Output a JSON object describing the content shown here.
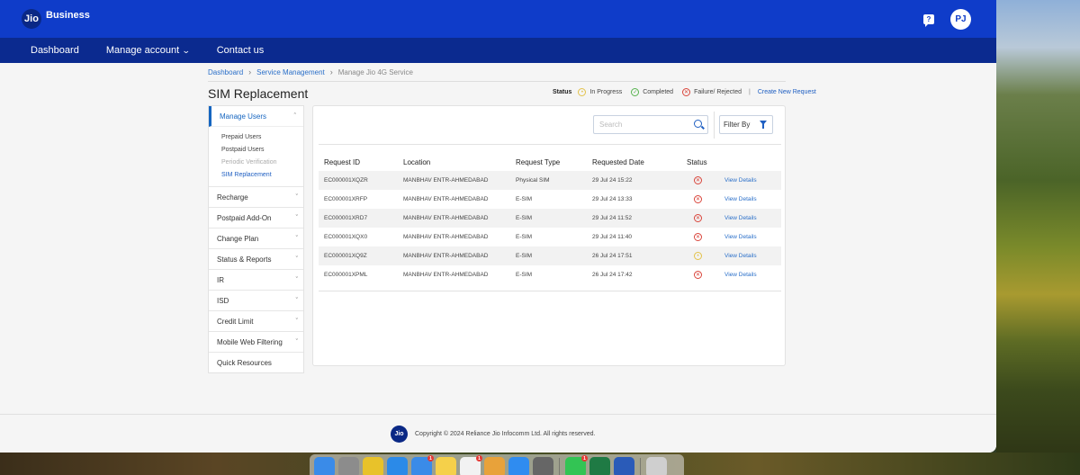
{
  "header": {
    "logo_mark": "Jio",
    "brand": "Business",
    "avatar_initials": "PJ",
    "chat_icon": "?"
  },
  "nav": {
    "items": [
      {
        "label": "Dashboard"
      },
      {
        "label": "Manage account",
        "has_dropdown": true
      },
      {
        "label": "Contact us"
      }
    ]
  },
  "breadcrumb": {
    "items": [
      "Dashboard",
      "Service Management",
      "Manage Jio 4G Service"
    ]
  },
  "page": {
    "title": "SIM Replacement"
  },
  "legend": {
    "label": "Status",
    "in_progress": "In Progress",
    "completed": "Completed",
    "failure": "Failure/ Rejected",
    "separator": "|",
    "create_link": "Create New Request"
  },
  "sidebar": {
    "section": "Manage Users",
    "subitems": [
      "Prepaid Users",
      "Postpaid Users",
      "Periodic Verification",
      "SIM Replacement"
    ],
    "items": [
      "Recharge",
      "Postpaid Add-On",
      "Change Plan",
      "Status & Reports",
      "IR",
      "ISD",
      "Credit Limit",
      "Mobile Web Filtering",
      "Quick Resources"
    ]
  },
  "toolbar": {
    "search_placeholder": "Search",
    "filter_label": "Filter By"
  },
  "table": {
    "headers": [
      "Request ID",
      "Location",
      "Request Type",
      "Requested Date",
      "Status"
    ],
    "rows": [
      {
        "id": "EC000001XQZR",
        "location": "MANBHAV ENTR-AHMEDABAD",
        "type": "Physical SIM",
        "date": "29 Jul 24 15:22",
        "status": "failure",
        "action": "View Details"
      },
      {
        "id": "EC000001XRFP",
        "location": "MANBHAV ENTR-AHMEDABAD",
        "type": "E-SIM",
        "date": "29 Jul 24 13:33",
        "status": "failure",
        "action": "View Details"
      },
      {
        "id": "EC000001XRD7",
        "location": "MANBHAV ENTR-AHMEDABAD",
        "type": "E-SIM",
        "date": "29 Jul 24 11:52",
        "status": "failure",
        "action": "View Details"
      },
      {
        "id": "EC000001XQX0",
        "location": "MANBHAV ENTR-AHMEDABAD",
        "type": "E-SIM",
        "date": "29 Jul 24 11:40",
        "status": "failure",
        "action": "View Details"
      },
      {
        "id": "EC000001XQ9Z",
        "location": "MANBHAV ENTR-AHMEDABAD",
        "type": "E-SIM",
        "date": "26 Jul 24 17:51",
        "status": "in_progress",
        "action": "View Details"
      },
      {
        "id": "EC000001XPML",
        "location": "MANBHAV ENTR-AHMEDABAD",
        "type": "E-SIM",
        "date": "26 Jul 24 17:42",
        "status": "failure",
        "action": "View Details"
      }
    ]
  },
  "footer": {
    "logo_mark": "Jio",
    "copyright": "Copyright © 2024 Reliance Jio Infocomm Ltd. All rights reserved."
  },
  "dock": {
    "apps": [
      {
        "name": "finder-icon",
        "color": "#3a8be8"
      },
      {
        "name": "launchpad-icon",
        "color": "#8c8c8c"
      },
      {
        "name": "chrome-icon",
        "color": "#e8c22a"
      },
      {
        "name": "safari-icon",
        "color": "#2b8ae8"
      },
      {
        "name": "mail-icon",
        "color": "#3a8be8",
        "badge": "1"
      },
      {
        "name": "notes-icon",
        "color": "#f5d04a"
      },
      {
        "name": "reminders-icon",
        "color": "#f2f2f2",
        "badge": "1"
      },
      {
        "name": "photos-icon",
        "color": "#e8a23a"
      },
      {
        "name": "app-store-icon",
        "color": "#2f8cf0"
      },
      {
        "name": "system-settings-icon",
        "color": "#666"
      },
      {
        "name": "whatsapp-icon",
        "color": "#33c454",
        "badge": "1"
      },
      {
        "name": "excel-icon",
        "color": "#1f7a44"
      },
      {
        "name": "word-icon",
        "color": "#2a5bb8"
      },
      {
        "name": "trash-icon",
        "color": "#cfcfcf"
      }
    ]
  },
  "colors": {
    "header_blue": "#0f3cc9",
    "nav_blue": "#0b2a8f",
    "link_blue": "#2a6fc9",
    "failure_red": "#d9443a",
    "progress_yellow": "#e3c24a",
    "completed_green": "#56b34d"
  }
}
